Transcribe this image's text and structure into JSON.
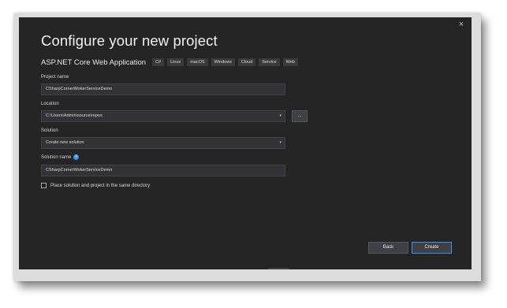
{
  "dialog": {
    "title": "Configure your new project",
    "close_label": "×",
    "template_name": "ASP.NET Core Web Application",
    "tags": [
      "C#",
      "Linux",
      "macOS",
      "Windows",
      "Cloud",
      "Service",
      "Web"
    ]
  },
  "form": {
    "project_name": {
      "label": "Project name",
      "value": "CSharpCornerWokerServiceDemo"
    },
    "location": {
      "label": "Location",
      "value": "C:\\Users\\Admin\\source\\repos",
      "browse_label": "..."
    },
    "solution": {
      "label": "Solution",
      "value": "Create new solution"
    },
    "solution_name": {
      "label": "Solution name",
      "value": "CSharpCornerWokerServiceDemo",
      "info_icon": "i"
    },
    "same_directory": {
      "label": "Place solution and project in the same directory",
      "checked": false
    }
  },
  "buttons": {
    "back": "Back",
    "create": "Create"
  },
  "icons": {
    "close": "close-icon",
    "info": "info-icon",
    "dropdown": "chevron-down-icon"
  },
  "colors": {
    "background": "#252526",
    "accent": "#3794ff",
    "field": "#333337"
  }
}
